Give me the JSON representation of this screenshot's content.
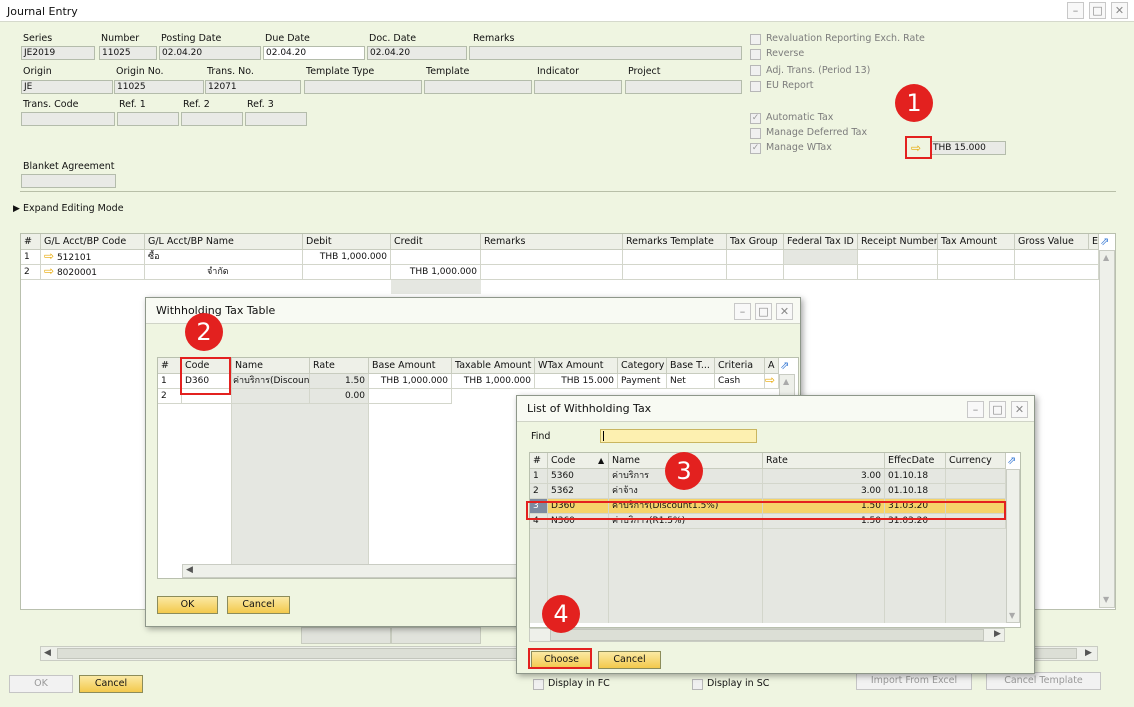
{
  "window": {
    "title": "Journal Entry"
  },
  "header": {
    "series": {
      "label": "Series",
      "value": "JE2019"
    },
    "number": {
      "label": "Number",
      "value": "11025"
    },
    "posting_date": {
      "label": "Posting Date",
      "value": "02.04.20"
    },
    "due_date": {
      "label": "Due Date",
      "value": "02.04.20"
    },
    "doc_date": {
      "label": "Doc. Date",
      "value": "02.04.20"
    },
    "remarks": {
      "label": "Remarks",
      "value": ""
    },
    "origin": {
      "label": "Origin",
      "value": "JE"
    },
    "origin_no": {
      "label": "Origin No.",
      "value": "11025"
    },
    "trans_no": {
      "label": "Trans. No.",
      "value": "12071"
    },
    "template_type": {
      "label": "Template Type",
      "value": ""
    },
    "template": {
      "label": "Template",
      "value": ""
    },
    "indicator": {
      "label": "Indicator",
      "value": ""
    },
    "project": {
      "label": "Project",
      "value": ""
    },
    "trans_code": {
      "label": "Trans. Code",
      "value": ""
    },
    "ref1": {
      "label": "Ref. 1",
      "value": ""
    },
    "ref2": {
      "label": "Ref. 2",
      "value": ""
    },
    "ref3": {
      "label": "Ref. 3",
      "value": ""
    },
    "blanket_agreement": {
      "label": "Blanket Agreement",
      "value": ""
    }
  },
  "options": {
    "revaluation": "Revaluation Reporting Exch. Rate",
    "reverse": "Reverse",
    "adj_trans": "Adj. Trans. (Period 13)",
    "eu_report": "EU Report",
    "automatic_tax": "Automatic Tax",
    "manage_deferred_tax": "Manage Deferred Tax",
    "manage_wtax": "Manage WTax",
    "wtax_amount": "THB 15.000"
  },
  "expand_label": "Expand Editing Mode",
  "je_grid": {
    "columns": [
      "#",
      "G/L Acct/BP Code",
      "G/L Acct/BP Name",
      "Debit",
      "Credit",
      "Remarks",
      "Remarks Template",
      "Tax Group",
      "Federal Tax ID",
      "Receipt Number",
      "Tax Amount",
      "Gross Value",
      "E"
    ],
    "rows": [
      {
        "num": "1",
        "code": "512101",
        "name": "ซื้อ",
        "debit": "THB 1,000.000",
        "credit": ""
      },
      {
        "num": "2",
        "code": "8020001",
        "name": "จำกัด",
        "debit": "",
        "credit": "THB 1,000.000"
      }
    ]
  },
  "footer": {
    "ok": "OK",
    "cancel": "Cancel",
    "display_fc": "Display in FC",
    "display_sc": "Display in SC",
    "import_excel": "Import From Excel",
    "cancel_template": "Cancel Template"
  },
  "wtax_dialog": {
    "title": "Withholding Tax Table",
    "columns": [
      "#",
      "Code",
      "Name",
      "Rate",
      "Base Amount",
      "Taxable Amount",
      "WTax Amount",
      "Category",
      "Base T...",
      "Criteria",
      "A"
    ],
    "rows": [
      {
        "num": "1",
        "code": "D360",
        "name": "ค่าบริการ(Discount",
        "rate": "1.50",
        "base": "THB 1,000.000",
        "taxable": "THB 1,000.000",
        "wtax": "THB 15.000",
        "category": "Payment",
        "base_type": "Net",
        "criteria": "Cash"
      },
      {
        "num": "2",
        "code": "",
        "name": "",
        "rate": "0.00",
        "base": "",
        "taxable": "",
        "wtax": "",
        "category": "",
        "base_type": "",
        "criteria": ""
      }
    ],
    "ok": "OK",
    "cancel": "Cancel"
  },
  "list_dialog": {
    "title": "List of Withholding Tax",
    "find_label": "Find",
    "find_value": "",
    "columns": [
      "#",
      "Code",
      "Name",
      "Rate",
      "EffecDate",
      "Currency"
    ],
    "rows": [
      {
        "num": "1",
        "code": "5360",
        "name": "ค่าบริการ",
        "rate": "3.00",
        "date": "01.10.18",
        "currency": ""
      },
      {
        "num": "2",
        "code": "5362",
        "name": "ค่าจ้าง",
        "rate": "3.00",
        "date": "01.10.18",
        "currency": ""
      },
      {
        "num": "3",
        "code": "D360",
        "name": "ค่าบริการ(Discount1.5%)",
        "rate": "1.50",
        "date": "31.03.20",
        "currency": ""
      },
      {
        "num": "4",
        "code": "N360",
        "name": "ค่าบริการ(R1.5%)",
        "rate": "1.50",
        "date": "31.03.20",
        "currency": ""
      }
    ],
    "choose": "Choose",
    "cancel": "Cancel"
  },
  "callouts": [
    "1",
    "2",
    "3",
    "4"
  ],
  "colors": {
    "background": "#eff5e1",
    "button": "#f3c94c",
    "callout": "#e3211f",
    "selected_row": "#f5d36a"
  }
}
